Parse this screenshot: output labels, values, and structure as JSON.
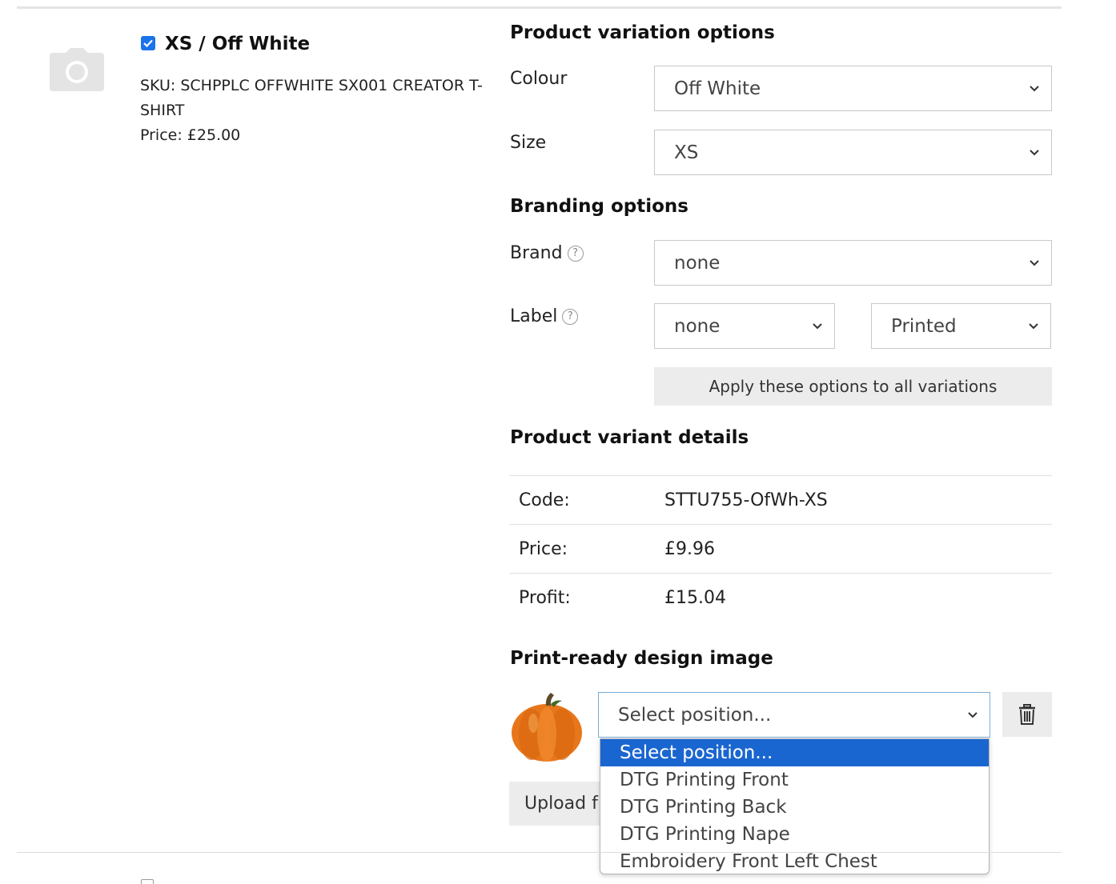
{
  "variant": {
    "title": "XS / Off White",
    "checked": true,
    "sku_line1": "SKU: SCHPPLC OFFWHITE SX001 CREATOR T-",
    "sku_line2": "SHIRT",
    "price": "Price: £25.00",
    "thumbnail_icon": "camera-icon"
  },
  "variation_options": {
    "heading": "Product variation options",
    "colour_label": "Colour",
    "colour_value": "Off White",
    "size_label": "Size",
    "size_value": "XS"
  },
  "branding_options": {
    "heading": "Branding options",
    "brand_label": "Brand",
    "brand_value": "none",
    "label_label": "Label",
    "label_value": "none",
    "label_type_value": "Printed",
    "help_glyph": "?",
    "apply_button": "Apply these options to all variations"
  },
  "variant_details": {
    "heading": "Product variant details",
    "rows": [
      {
        "key": "Code:",
        "value": "STTU755-OfWh-XS"
      },
      {
        "key": "Price:",
        "value": "£9.96"
      },
      {
        "key": "Profit:",
        "value": "£15.04"
      }
    ]
  },
  "design_image": {
    "heading": "Print-ready design image",
    "position_select_value": "Select position...",
    "upload_button": "Upload f",
    "delete_icon": "trash-icon",
    "design_thumbnail_icon": "pumpkin-image",
    "dropdown_options": [
      {
        "label": "Select position...",
        "selected": true
      },
      {
        "label": "DTG Printing Front",
        "selected": false
      },
      {
        "label": "DTG Printing Back",
        "selected": false
      },
      {
        "label": "DTG Printing Nape",
        "selected": false
      },
      {
        "label": "Embroidery Front Left Chest",
        "selected": false
      }
    ]
  },
  "colors": {
    "accent": "#1a73e8",
    "selected_option": "#1a66d0",
    "button_bg": "#ececec",
    "pumpkin": "#e8761a"
  }
}
